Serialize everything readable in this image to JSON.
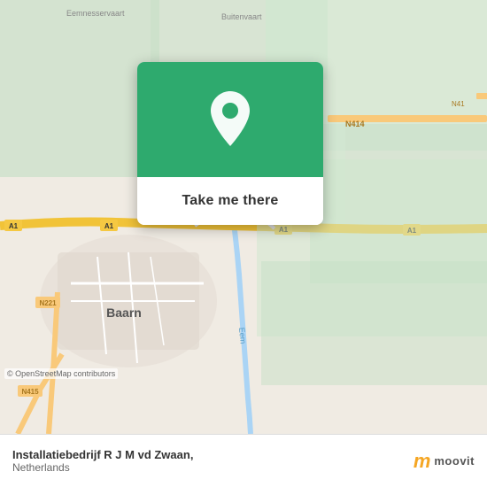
{
  "map": {
    "attribution": "© OpenStreetMap contributors",
    "background_color": "#f0ebe3"
  },
  "popup": {
    "button_label": "Take me there",
    "pin_icon": "location-pin-icon"
  },
  "bottom_bar": {
    "location_name": "Installatiebedrijf R J M vd Zwaan,",
    "location_country": "Netherlands",
    "logo_m": "m",
    "logo_text": "moovit"
  }
}
